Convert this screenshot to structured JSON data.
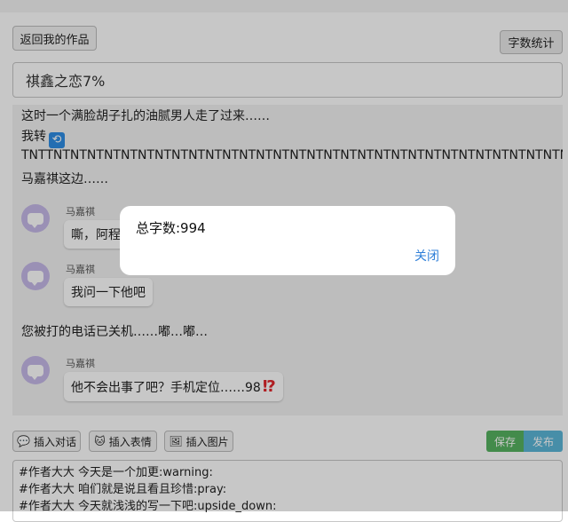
{
  "header": {
    "back_label": "返回我的作品",
    "word_count_label": "字数统计"
  },
  "title_input": {
    "value": "祺鑫之恋7%"
  },
  "story": {
    "line1": "这时一个满脸胡子扎的油腻男人走了过来……",
    "line2": "我转",
    "line3": "TNTTNTNTNTNTNTNTNTNTNTNTNTNTNTNTNTNTNTNTNTNTNTNTNTNTNTNTNTNTNTNTN",
    "line4": "马嘉祺这边……",
    "messages": [
      {
        "speaker": "马嘉祺",
        "text": "嘶，阿程怎"
      },
      {
        "speaker": "马嘉祺",
        "text": "我问一下他吧"
      }
    ],
    "line5": "您被打的电话已关机……嘟…嘟…",
    "last_message": {
      "speaker": "马嘉祺",
      "text": "他不会出事了吧？手机定位……98",
      "emoji": "⁉"
    }
  },
  "dialog": {
    "message": "总字数:994",
    "close_label": "关闭"
  },
  "toolbar": {
    "insert_dialog": "插入对话",
    "insert_emoji": "插入表情",
    "insert_image": "插入图片",
    "save": "保存",
    "publish": "发布"
  },
  "editor": {
    "lines": [
      "#作者大大 今天是一个加更:warning:",
      "#作者大大 咱们就是说且看且珍惜:pray:",
      "#作者大大 今天就浅浅的写一下吧:upside_down:"
    ]
  },
  "icons": {
    "refresh": "refresh-icon",
    "avatar": "chat-bubble-icon",
    "dialog": "comment-icon",
    "emoji": "cat-icon",
    "image": "image-icon"
  }
}
